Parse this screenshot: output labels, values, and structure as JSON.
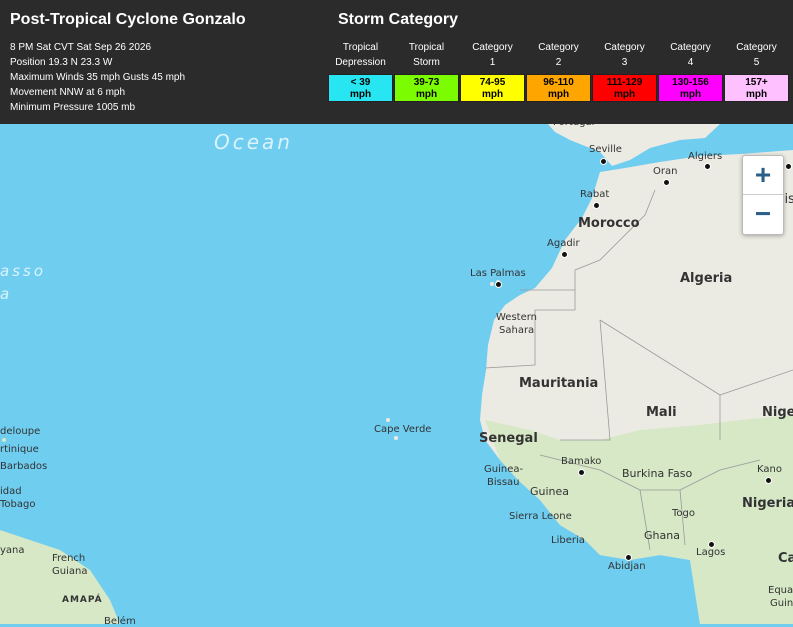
{
  "header": {
    "storm_title": "Post-Tropical Cyclone Gonzalo",
    "info": [
      "8 PM Sat CVT Sat Sep 26 2026",
      "Position 19.3 N 23.3 W",
      "Maximum Winds 35 mph Gusts 45 mph",
      "Movement NNW at 6 mph",
      "Minimum Pressure 1005 mb"
    ],
    "category_title": "Storm Category"
  },
  "legend": [
    {
      "line1": "Tropical",
      "line2": "Depression",
      "range": "< 39",
      "unit": "mph",
      "color": "#27e6f2",
      "text_color": "#000"
    },
    {
      "line1": "Tropical",
      "line2": "Storm",
      "range": "39-73",
      "unit": "mph",
      "color": "#7cfc00",
      "text_color": "#000"
    },
    {
      "line1": "Category",
      "line2": "1",
      "range": "74-95",
      "unit": "mph",
      "color": "#ffff00",
      "text_color": "#000"
    },
    {
      "line1": "Category",
      "line2": "2",
      "range": "96-110",
      "unit": "mph",
      "color": "#ffa500",
      "text_color": "#000"
    },
    {
      "line1": "Category",
      "line2": "3",
      "range": "111-129",
      "unit": "mph",
      "color": "#ff0000",
      "text_color": "#000"
    },
    {
      "line1": "Category",
      "line2": "4",
      "range": "130-156",
      "unit": "mph",
      "color": "#ff00ff",
      "text_color": "#000"
    },
    {
      "line1": "Category",
      "line2": "5",
      "range": "157+",
      "unit": "mph",
      "color": "#ffc0ff",
      "text_color": "#000"
    }
  ],
  "zoom": {
    "in": "+",
    "out": "−"
  },
  "map_labels": {
    "ocean": "Ocean",
    "sargasso": "asso",
    "sargasso2": "a",
    "portugal": "Portugal",
    "seville": "Seville",
    "algiers": "Algiers",
    "oran": "Oran",
    "tunis": "Tunis",
    "rabat": "Rabat",
    "morocco": "Morocco",
    "agadir": "Agadir",
    "las_palmas": "Las Palmas",
    "algeria": "Algeria",
    "western": "Western",
    "sahara": "Sahara",
    "mauritania": "Mauritania",
    "mali": "Mali",
    "niger": "Niger",
    "cape_verde": "Cape Verde",
    "senegal": "Senegal",
    "bamako": "Bamako",
    "burkina": "Burkina Faso",
    "kano": "Kano",
    "guinea_bissau1": "Guinea-",
    "guinea_bissau2": "Bissau",
    "guinea": "Guinea",
    "nigeria": "Nigeria",
    "togo": "Togo",
    "sierra_leone": "Sierra Leone",
    "ghana": "Ghana",
    "liberia": "Liberia",
    "lagos": "Lagos",
    "abidjan": "Abidjan",
    "guadeloupe": "deloupe",
    "martinique": "rtinique",
    "barbados": "Barbados",
    "trinidad1": "idad",
    "trinidad2": "Tobago",
    "guyana": "yana",
    "french1": "French",
    "french2": "Guiana",
    "amapa": "AMAPÁ",
    "belem": "Belém",
    "equat": "Equa",
    "guin": "Guin",
    "ca": "Ca"
  }
}
